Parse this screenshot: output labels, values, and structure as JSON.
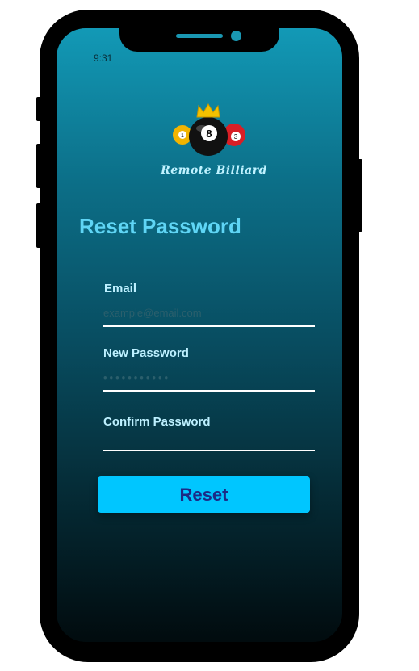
{
  "status_bar": {
    "time": "9:31"
  },
  "logo": {
    "app_name": "Remote Billiard",
    "ball_8": "8",
    "ball_3": "3",
    "ball_1": "1"
  },
  "page": {
    "title": "Reset Password"
  },
  "form": {
    "email_label": "Email",
    "email_placeholder": "example@email.com",
    "new_password_label": "New Password",
    "new_password_placeholder": "•••••••••••",
    "confirm_password_label": "Confirm Password",
    "confirm_password_placeholder": "",
    "reset_button": "Reset"
  },
  "colors": {
    "accent": "#00c6ff",
    "button_text": "#1c2a86",
    "title": "#5fd5f5"
  }
}
